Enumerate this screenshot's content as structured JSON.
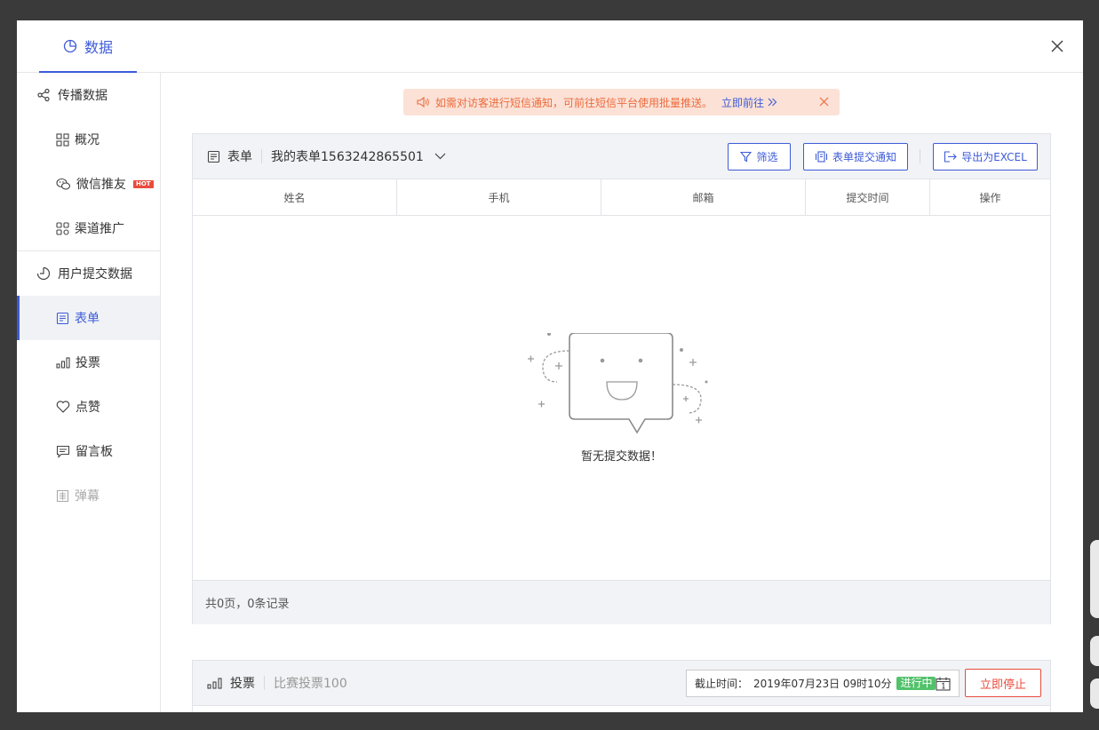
{
  "modal": {
    "tab_label": "数据"
  },
  "sidebar": {
    "group1": "传播数据",
    "items1": [
      {
        "label": "概况",
        "icon": "grid-icon"
      },
      {
        "label": "微信推友",
        "icon": "wechat-icon",
        "badge": "HOT"
      },
      {
        "label": "渠道推广",
        "icon": "channel-icon"
      }
    ],
    "group2": "用户提交数据",
    "items2": [
      {
        "label": "表单",
        "icon": "form-icon",
        "active": true
      },
      {
        "label": "投票",
        "icon": "bar-chart-icon"
      },
      {
        "label": "点赞",
        "icon": "heart-icon"
      },
      {
        "label": "留言板",
        "icon": "message-board-icon"
      },
      {
        "label": "弹幕",
        "icon": "danmu-icon",
        "disabled": true
      }
    ]
  },
  "notice": {
    "text": "如需对访客进行短信通知，可前往短信平台使用批量推送。",
    "link": "立即前往"
  },
  "form_panel": {
    "title": "表单",
    "selected_form": "我的表单1563242865501",
    "filter_btn": "筛选",
    "notify_btn": "表单提交通知",
    "export_btn": "导出为EXCEL",
    "columns": [
      "姓名",
      "手机",
      "邮箱",
      "提交时间",
      "操作"
    ],
    "empty_text": "暂无提交数据！",
    "footer": "共0页，0条记录"
  },
  "vote_panel": {
    "title": "投票",
    "subtitle": "比赛投票100",
    "deadline_label": "截止时间：",
    "deadline_value": "2019年07月23日 09时10分",
    "status": "进行中",
    "stop_btn": "立即停止"
  },
  "colors": {
    "accent": "#3d5bd8",
    "notice_bg": "#fbe1d6",
    "notice_text": "#ee6b3d",
    "danger": "#e84c3d",
    "success": "#52c26b"
  }
}
